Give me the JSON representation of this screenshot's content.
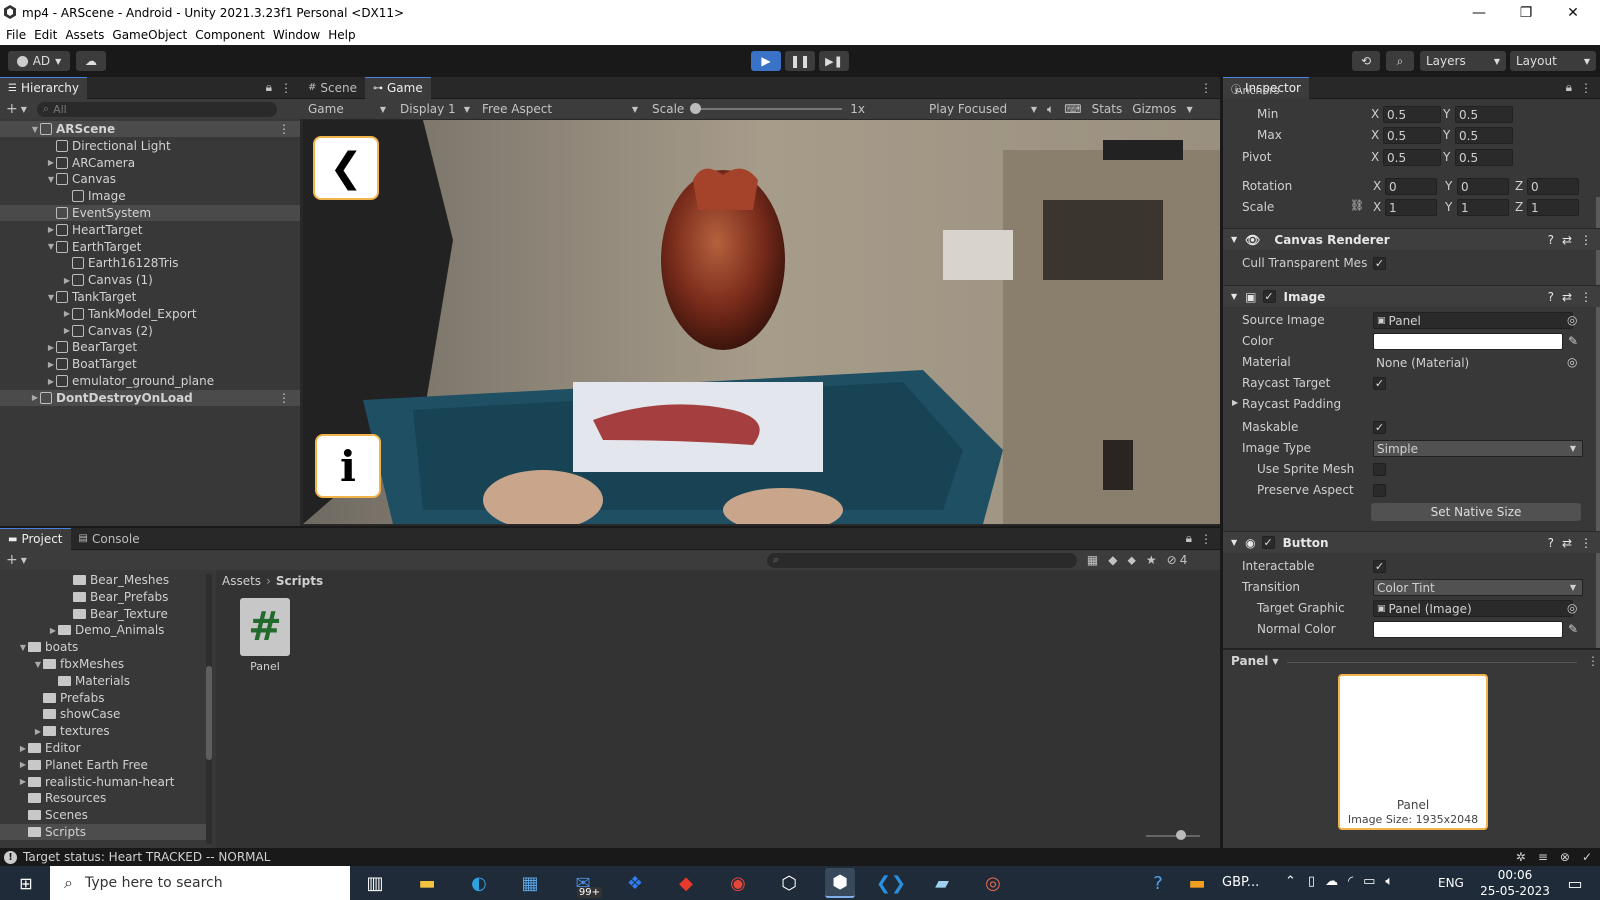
{
  "window": {
    "title": "mp4 - ARScene - Android - Unity 2021.3.23f1 Personal <DX11>"
  },
  "menu": [
    "File",
    "Edit",
    "Assets",
    "GameObject",
    "Component",
    "Window",
    "Help"
  ],
  "toolbar": {
    "account": "AD",
    "layers": "Layers",
    "layout": "Layout"
  },
  "hierarchy": {
    "tab": "Hierarchy",
    "search_placeholder": "All",
    "items": [
      {
        "label": "ARScene",
        "depth": 0,
        "arrow": "▼",
        "scene": true
      },
      {
        "label": "Directional Light",
        "depth": 1,
        "arrow": ""
      },
      {
        "label": "ARCamera",
        "depth": 1,
        "arrow": "▶"
      },
      {
        "label": "Canvas",
        "depth": 1,
        "arrow": "▼"
      },
      {
        "label": "Image",
        "depth": 2,
        "arrow": ""
      },
      {
        "label": "EventSystem",
        "depth": 1,
        "arrow": "",
        "selected": true
      },
      {
        "label": "HeartTarget",
        "depth": 1,
        "arrow": "▶"
      },
      {
        "label": "EarthTarget",
        "depth": 1,
        "arrow": "▼"
      },
      {
        "label": "Earth16128Tris",
        "depth": 2,
        "arrow": ""
      },
      {
        "label": "Canvas (1)",
        "depth": 2,
        "arrow": "▶"
      },
      {
        "label": "TankTarget",
        "depth": 1,
        "arrow": "▼"
      },
      {
        "label": "TankModel_Export",
        "depth": 2,
        "arrow": "▶"
      },
      {
        "label": "Canvas (2)",
        "depth": 2,
        "arrow": "▶"
      },
      {
        "label": "BearTarget",
        "depth": 1,
        "arrow": "▶"
      },
      {
        "label": "BoatTarget",
        "depth": 1,
        "arrow": "▶"
      },
      {
        "label": "emulator_ground_plane",
        "depth": 1,
        "arrow": "▶"
      },
      {
        "label": "DontDestroyOnLoad",
        "depth": 0,
        "arrow": "▶",
        "scene": true
      }
    ]
  },
  "game": {
    "tabs": [
      "Scene",
      "Game"
    ],
    "view_select": "Game",
    "display": "Display 1",
    "aspect": "Free Aspect",
    "scale_label": "Scale",
    "scale_value": "1x",
    "play_mode": "Play Focused",
    "stats": "Stats",
    "gizmos": "Gizmos",
    "info_glyph": "i"
  },
  "inspector": {
    "tab": "Inspector",
    "anchors_label": "Anchors",
    "min": {
      "label": "Min",
      "x": "0.5",
      "y": "0.5"
    },
    "max": {
      "label": "Max",
      "x": "0.5",
      "y": "0.5"
    },
    "pivot": {
      "label": "Pivot",
      "x": "0.5",
      "y": "0.5"
    },
    "rotation": {
      "label": "Rotation",
      "x": "0",
      "y": "0",
      "z": "0"
    },
    "scale": {
      "label": "Scale",
      "x": "1",
      "y": "1",
      "z": "1"
    },
    "axis_x": "X",
    "axis_y": "Y",
    "axis_z": "Z",
    "canvas_renderer": {
      "title": "Canvas Renderer",
      "cull_label": "Cull Transparent Mes"
    },
    "image": {
      "title": "Image",
      "source_label": "Source Image",
      "source_value": "Panel",
      "color_label": "Color",
      "material_label": "Material",
      "material_value": "None (Material)",
      "raycast_label": "Raycast Target",
      "padding_label": "Raycast Padding",
      "maskable_label": "Maskable",
      "type_label": "Image Type",
      "type_value": "Simple",
      "sprite_mesh_label": "Use Sprite Mesh",
      "preserve_label": "Preserve Aspect",
      "native_button": "Set Native Size"
    },
    "button": {
      "title": "Button",
      "interactable_label": "Interactable",
      "transition_label": "Transition",
      "transition_value": "Color Tint",
      "target_label": "Target Graphic",
      "target_value": "Panel (Image)",
      "normal_label": "Normal Color"
    },
    "preview": {
      "dropdown": "Panel",
      "name": "Panel",
      "size": "Image Size: 1935x2048"
    }
  },
  "project": {
    "tabs": [
      "Project",
      "Console"
    ],
    "breadcrumb": [
      "Assets",
      "Scripts"
    ],
    "hidden_count": "4",
    "tree": [
      {
        "label": "Bear_Meshes",
        "depth": 3,
        "arrow": ""
      },
      {
        "label": "Bear_Prefabs",
        "depth": 3,
        "arrow": ""
      },
      {
        "label": "Bear_Texture",
        "depth": 3,
        "arrow": ""
      },
      {
        "label": "Demo_Animals",
        "depth": 2,
        "arrow": "▶"
      },
      {
        "label": "boats",
        "depth": 0,
        "arrow": "▼"
      },
      {
        "label": "fbxMeshes",
        "depth": 1,
        "arrow": "▼"
      },
      {
        "label": "Materials",
        "depth": 2,
        "arrow": ""
      },
      {
        "label": "Prefabs",
        "depth": 1,
        "arrow": ""
      },
      {
        "label": "showCase",
        "depth": 1,
        "arrow": ""
      },
      {
        "label": "textures",
        "depth": 1,
        "arrow": "▶"
      },
      {
        "label": "Editor",
        "depth": 0,
        "arrow": "▶"
      },
      {
        "label": "Planet Earth Free",
        "depth": 0,
        "arrow": "▶"
      },
      {
        "label": "realistic-human-heart",
        "depth": 0,
        "arrow": "▶"
      },
      {
        "label": "Resources",
        "depth": 0,
        "arrow": ""
      },
      {
        "label": "Scenes",
        "depth": 0,
        "arrow": ""
      },
      {
        "label": "Scripts",
        "depth": 0,
        "arrow": "",
        "selected": true
      }
    ],
    "asset": {
      "name": "Panel",
      "glyph": "#"
    }
  },
  "status": {
    "text": "Target status: Heart TRACKED -- NORMAL"
  },
  "taskbar": {
    "search_placeholder": "Type here to search",
    "mail_badge": "99+",
    "tray_text": "GBP...",
    "lang": "ENG",
    "time": "00:06",
    "date": "25-05-2023"
  },
  "colors": {
    "accent": "#4a80e0",
    "play_active": "#3a72c8",
    "ui_button_border": "#f2b24c"
  }
}
